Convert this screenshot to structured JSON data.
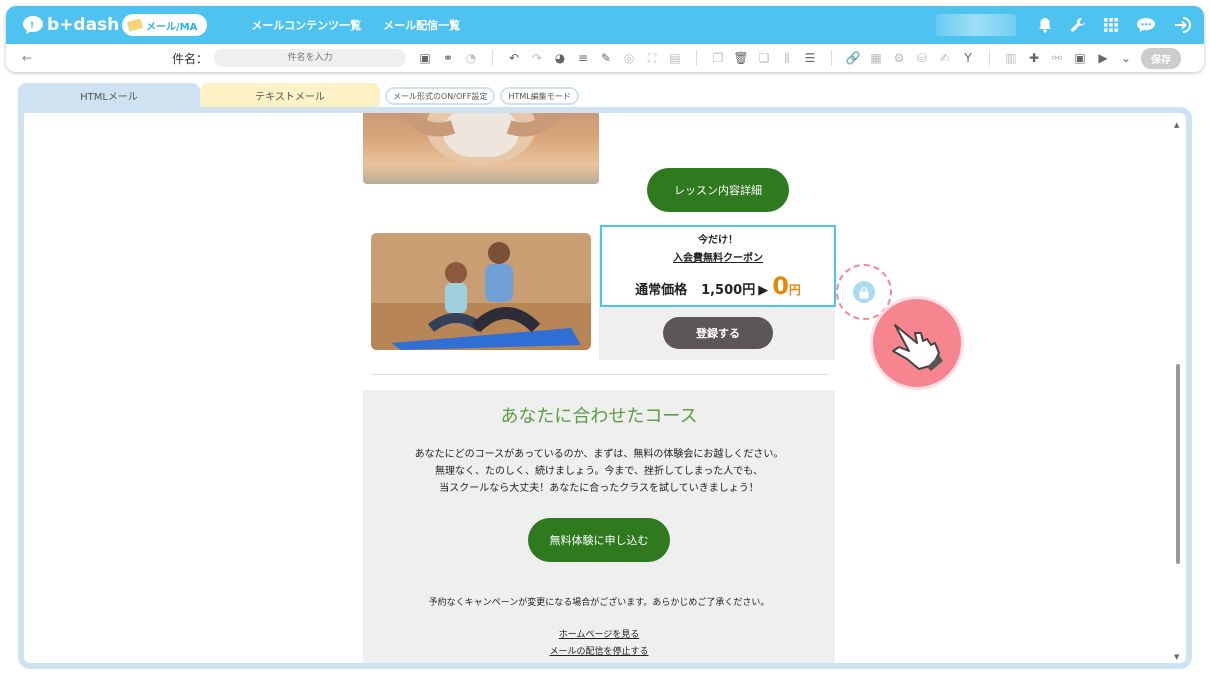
{
  "app": {
    "logo_text": "b+dash",
    "module_pill": "メール/MA",
    "nav": [
      "メールコンテンツ一覧",
      "メール配信一覧"
    ]
  },
  "toolbar": {
    "back_label": "←",
    "subject_label": "件名：",
    "subject_placeholder": "件名を入力",
    "save_label": "保存"
  },
  "tabs": {
    "html_mail": "HTMLメール",
    "text_mail": "テキストメール",
    "format_toggle": "メール形式のON/OFF設定",
    "html_edit_mode": "HTML編集モード"
  },
  "email": {
    "lesson_button": "レッスン内容詳細",
    "coupon": {
      "line1": "今だけ！",
      "line2": "入会費無料クーポン",
      "regular_label": "通常価格",
      "regular_price": "1,500円",
      "arrow": "▶",
      "sale_price": "0",
      "sale_unit": "円"
    },
    "register_button": "登録する",
    "course_title": "あなたに合わせたコース",
    "course_body": [
      "あなたにどのコースがあっているのか、まずは、無料の体験会にお越しください。",
      "無理なく、たのしく、続けましょう。今まで、挫折してしまった人でも、",
      "当スクールなら大丈夫！あなたに合ったクラスを試していきましょう！"
    ],
    "trial_button": "無料体験に申し込む",
    "notice": "予約なくキャンペーンが変更になる場合がございます。あらかじめご了承ください。",
    "link_homepage": "ホームページを見る",
    "link_unsubscribe": "メールの配信を停止する"
  },
  "colors": {
    "header_blue": "#4fc3ef",
    "button_green": "#2f7a1f",
    "coupon_orange": "#e28a0b",
    "course_title_green": "#5c9e45",
    "highlight_pink": "#f7858f"
  },
  "icons": {
    "top": [
      "bell-icon",
      "wrench-icon",
      "grid-icon",
      "chat-icon",
      "logout-icon"
    ],
    "overlay": [
      "lock-icon",
      "pointing-hand-icon"
    ]
  }
}
